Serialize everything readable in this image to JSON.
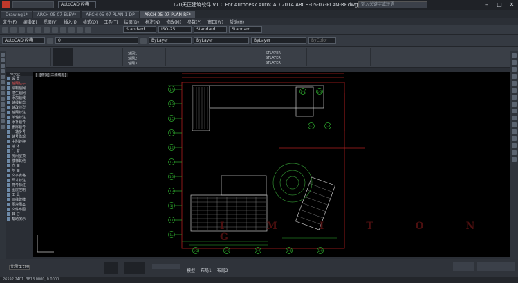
{
  "window": {
    "title": "T20天正建筑软件 V1.0 For Autodesk AutoCAD 2014   ARCH-05-07-PLAN-RF.dwg",
    "search_placeholder": "键入关键字或短语"
  },
  "quick_access": {
    "workspace": "AutoCAD 经典"
  },
  "tabs": [
    {
      "label": "Drawing1*"
    },
    {
      "label": "ARCH-05-07-ELEV*"
    },
    {
      "label": "ARCH-05-07-PLAN-1-DP"
    },
    {
      "label": "ARCH-05-07-PLAN-RF*"
    }
  ],
  "menu": [
    "文件(F)",
    "编辑(E)",
    "视图(V)",
    "插入(I)",
    "格式(O)",
    "工具(T)",
    "绘图(D)",
    "标注(N)",
    "修改(M)",
    "参数(P)",
    "窗口(W)",
    "帮助(H)"
  ],
  "toolbar": {
    "workspace_combo": "AutoCAD 经典",
    "text_style": "Standard",
    "dim_style": "ISO-25",
    "table_style": "Standard",
    "mleader_style": "Standard",
    "layer_combo": "0",
    "color_combo": "ByLayer",
    "linetype_combo": "ByLayer",
    "lineweight_combo": "ByLayer",
    "plot_style": "ByColor"
  },
  "ribbon": {
    "labels": [
      "轴网1",
      "轴网2",
      "轴网3",
      "STLAYER",
      "STLAYER",
      "STLAYER"
    ]
  },
  "palette": {
    "title": "T20天正",
    "items": [
      "设 置",
      "轴网柱子",
      "绘制轴网",
      "墙生轴网",
      "添加轴线",
      "轴线裁剪",
      "轴改线型",
      "轴网标注",
      "单轴标注",
      "添补轴号",
      "删除轴号",
      "一轴多号",
      "轴号隐现",
      "主附转换",
      "墙 体",
      "门 窗",
      "房间屋顶",
      "楼梯其他",
      "立 面",
      "剖 面",
      "文字表格",
      "尺寸标注",
      "符号标注",
      "图层控制",
      "工 具",
      "三维建模",
      "图块图案",
      "文件布图",
      "其 它",
      "帮助演示"
    ]
  },
  "canvas": {
    "view_label": "[-][俯视][二维线框]",
    "watermark": "I M I T O N G",
    "axis_labels_left": [
      "1A",
      "1B",
      "1C",
      "1D",
      "1E",
      "1F",
      "1G",
      "1H",
      "1J",
      "1K",
      "1L"
    ],
    "axis_labels_top": [
      "1-1",
      "1-2",
      "1-3",
      "1-4"
    ],
    "axis_labels_bottom": [
      "1-5",
      "1-6",
      "1-7",
      "1-8",
      "1-9"
    ]
  },
  "bottom": {
    "scale": "比例 1:100",
    "model_tab": "模型",
    "layout_tabs": [
      "布局1",
      "布局2"
    ],
    "coords": "26592.2401, 3813.0000, 0.0000"
  }
}
